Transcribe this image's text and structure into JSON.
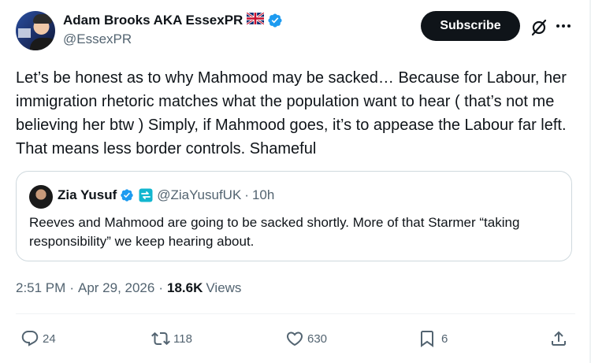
{
  "author": {
    "display_name": "Adam Brooks AKA EssexPR",
    "handle": "@EssexPR"
  },
  "header": {
    "subscribe_label": "Subscribe"
  },
  "tweet": {
    "text": "Let’s be honest as to why Mahmood may be sacked… Because for Labour, her immigration rhetoric matches what the population want to hear  ( that’s not me believing her btw ) Simply, if Mahmood goes, it’s to appease the Labour far left. That means less border controls. Shameful",
    "time": "2:51 PM",
    "separator": "·",
    "date": "Apr 29, 2026",
    "views_count": "18.6K",
    "views_label": "Views"
  },
  "quote": {
    "display_name": "Zia Yusuf",
    "handle": "@ZiaYusufUK",
    "separator": "·",
    "time": "10h",
    "text": "Reeves and Mahmood are going to be sacked shortly. More of that Starmer “taking responsibility” we keep hearing about."
  },
  "actions": {
    "replies": "24",
    "reposts": "118",
    "likes": "630",
    "bookmarks": "6"
  },
  "icons": [
    "union-jack-flag-icon",
    "verified-badge-icon",
    "grok-icon",
    "more-icon",
    "party-badge-icon",
    "reply-icon",
    "repost-icon",
    "like-icon",
    "bookmark-icon",
    "share-icon"
  ],
  "colors": {
    "text": "#0f1419",
    "secondary": "#536471",
    "verified": "#1d9bf0",
    "border": "#cfd9de",
    "subscribe_bg": "#0f1419"
  }
}
